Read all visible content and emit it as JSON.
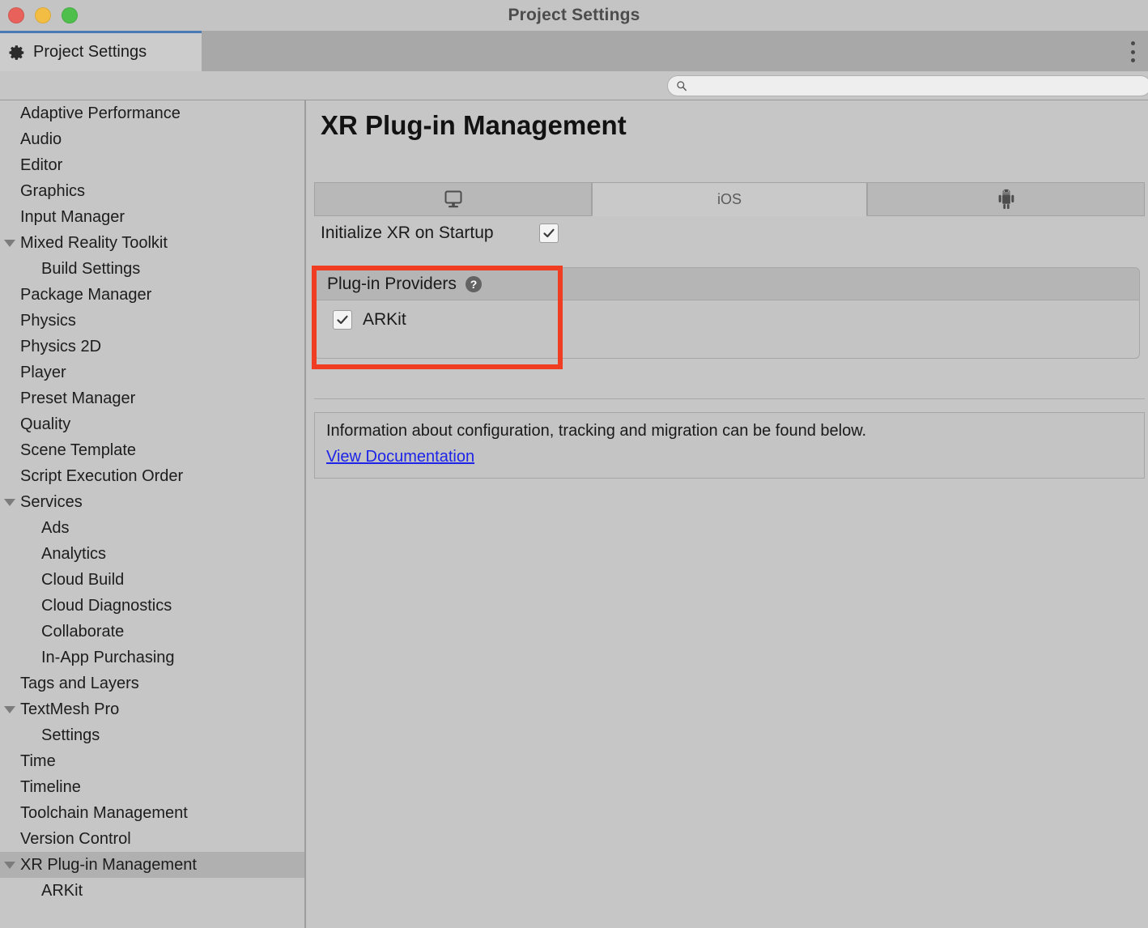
{
  "window": {
    "title": "Project Settings",
    "controls": [
      "close",
      "minimize",
      "maximize"
    ]
  },
  "editor_tab": {
    "label": "Project Settings",
    "icon": "gear-icon",
    "accent_color": "#4a7ab5"
  },
  "overflow_menu": {
    "icon": "kebab-menu-icon"
  },
  "search": {
    "value": "",
    "placeholder": "",
    "icon": "search-icon"
  },
  "sidebar": {
    "items": [
      {
        "label": "Adaptive Performance",
        "level": 0,
        "foldout": false,
        "selected": false
      },
      {
        "label": "Audio",
        "level": 0,
        "foldout": false,
        "selected": false
      },
      {
        "label": "Editor",
        "level": 0,
        "foldout": false,
        "selected": false
      },
      {
        "label": "Graphics",
        "level": 0,
        "foldout": false,
        "selected": false
      },
      {
        "label": "Input Manager",
        "level": 0,
        "foldout": false,
        "selected": false
      },
      {
        "label": "Mixed Reality Toolkit",
        "level": 0,
        "foldout": true,
        "selected": false
      },
      {
        "label": "Build Settings",
        "level": 1,
        "foldout": false,
        "selected": false
      },
      {
        "label": "Package Manager",
        "level": 0,
        "foldout": false,
        "selected": false
      },
      {
        "label": "Physics",
        "level": 0,
        "foldout": false,
        "selected": false
      },
      {
        "label": "Physics 2D",
        "level": 0,
        "foldout": false,
        "selected": false
      },
      {
        "label": "Player",
        "level": 0,
        "foldout": false,
        "selected": false
      },
      {
        "label": "Preset Manager",
        "level": 0,
        "foldout": false,
        "selected": false
      },
      {
        "label": "Quality",
        "level": 0,
        "foldout": false,
        "selected": false
      },
      {
        "label": "Scene Template",
        "level": 0,
        "foldout": false,
        "selected": false
      },
      {
        "label": "Script Execution Order",
        "level": 0,
        "foldout": false,
        "selected": false
      },
      {
        "label": "Services",
        "level": 0,
        "foldout": true,
        "selected": false
      },
      {
        "label": "Ads",
        "level": 1,
        "foldout": false,
        "selected": false
      },
      {
        "label": "Analytics",
        "level": 1,
        "foldout": false,
        "selected": false
      },
      {
        "label": "Cloud Build",
        "level": 1,
        "foldout": false,
        "selected": false
      },
      {
        "label": "Cloud Diagnostics",
        "level": 1,
        "foldout": false,
        "selected": false
      },
      {
        "label": "Collaborate",
        "level": 1,
        "foldout": false,
        "selected": false
      },
      {
        "label": "In-App Purchasing",
        "level": 1,
        "foldout": false,
        "selected": false
      },
      {
        "label": "Tags and Layers",
        "level": 0,
        "foldout": false,
        "selected": false
      },
      {
        "label": "TextMesh Pro",
        "level": 0,
        "foldout": true,
        "selected": false
      },
      {
        "label": "Settings",
        "level": 1,
        "foldout": false,
        "selected": false
      },
      {
        "label": "Time",
        "level": 0,
        "foldout": false,
        "selected": false
      },
      {
        "label": "Timeline",
        "level": 0,
        "foldout": false,
        "selected": false
      },
      {
        "label": "Toolchain Management",
        "level": 0,
        "foldout": false,
        "selected": false
      },
      {
        "label": "Version Control",
        "level": 0,
        "foldout": false,
        "selected": false
      },
      {
        "label": "XR Plug-in Management",
        "level": 0,
        "foldout": true,
        "selected": true
      },
      {
        "label": "ARKit",
        "level": 1,
        "foldout": false,
        "selected": false
      }
    ]
  },
  "main": {
    "title": "XR Plug-in Management",
    "platform_tabs": [
      {
        "label": "",
        "icon": "desktop-monitor-icon",
        "active": false
      },
      {
        "label": "iOS",
        "icon": "",
        "active": true
      },
      {
        "label": "",
        "icon": "android-robot-icon",
        "active": false
      }
    ],
    "initialize_xr": {
      "label": "Initialize XR on Startup",
      "checked": true
    },
    "providers": {
      "header": "Plug-in Providers",
      "help_icon": "help-question-icon",
      "rows": [
        {
          "label": "ARKit",
          "checked": true
        }
      ]
    },
    "info": {
      "text": "Information about configuration, tracking and migration can be found below.",
      "link": "View Documentation",
      "link_color": "#1d24e8"
    },
    "annotation": {
      "color": "#f03c20",
      "target": "plug-in-providers-box"
    }
  }
}
